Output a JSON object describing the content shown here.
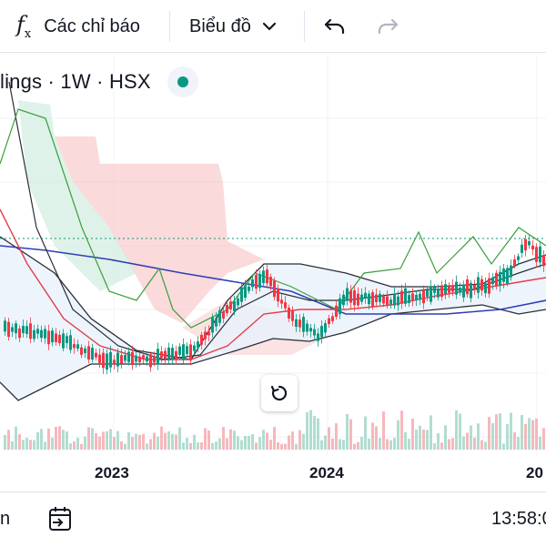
{
  "toolbar": {
    "indicators_icon": "fx-icon",
    "indicators_label": "Các chỉ báo",
    "chart_type_label": "Biểu đồ",
    "chevron_icon": "chevron-down-icon",
    "undo_icon": "undo-icon",
    "redo_icon": "redo-icon"
  },
  "legend": {
    "symbol_text": "lings · 1W · HSX",
    "status_color": "#089981"
  },
  "reset_icon": "reset-icon",
  "xaxis": {
    "labels": [
      "2023",
      "2024",
      "20"
    ]
  },
  "bottom": {
    "left_text": "n",
    "goto_icon": "calendar-goto-icon",
    "time_text": "13:58:0"
  },
  "colors": {
    "up": "#089981",
    "down": "#f23645",
    "cloud_red": "#f7c1c3",
    "cloud_green": "#d1ecdf",
    "band_fill": "#e8f1fb",
    "dotted_line": "#089981"
  }
}
